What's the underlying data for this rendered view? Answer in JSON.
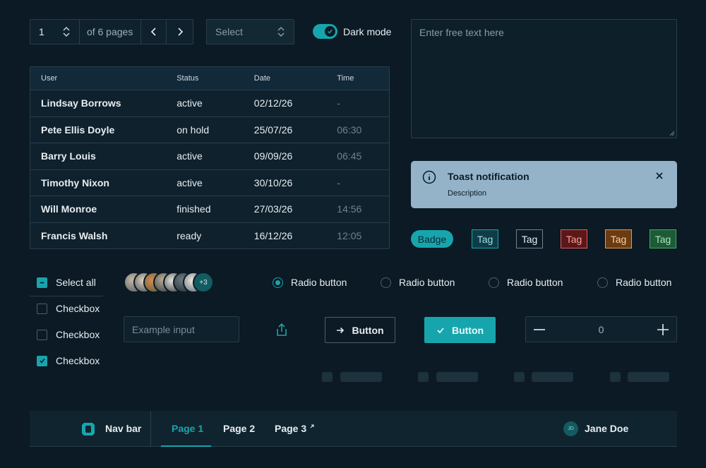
{
  "pagination": {
    "current": "1",
    "of_label": "of 6 pages"
  },
  "select": {
    "placeholder": "Select"
  },
  "dark_mode": {
    "label": "Dark mode",
    "on": true
  },
  "textarea": {
    "placeholder": "Enter free text here"
  },
  "table": {
    "headers": [
      "User",
      "Status",
      "Date",
      "Time"
    ],
    "rows": [
      [
        "Lindsay Borrows",
        "active",
        "02/12/26",
        "-"
      ],
      [
        "Pete Ellis Doyle",
        "on hold",
        "25/07/26",
        "06:30"
      ],
      [
        "Barry Louis",
        "active",
        "09/09/26",
        "06:45"
      ],
      [
        "Timothy Nixon",
        "active",
        "30/10/26",
        "-"
      ],
      [
        "Will Monroe",
        "finished",
        "27/03/26",
        "14:56"
      ],
      [
        "Francis Walsh",
        "ready",
        "16/12/26",
        "12:05"
      ]
    ]
  },
  "toast": {
    "title": "Toast notification",
    "description": "Description"
  },
  "badge": {
    "label": "Badge"
  },
  "tags": [
    {
      "label": "Tag",
      "color": "#17a5ad"
    },
    {
      "label": "Tag",
      "color": "#9fb0bb"
    },
    {
      "label": "Tag",
      "color": "#e25a5a"
    },
    {
      "label": "Tag",
      "color": "#e79a4e"
    },
    {
      "label": "Tag",
      "color": "#3fae6a"
    }
  ],
  "checkboxes": {
    "select_all": "Select all",
    "items": [
      {
        "label": "Checkbox",
        "checked": false
      },
      {
        "label": "Checkbox",
        "checked": false
      },
      {
        "label": "Checkbox",
        "checked": true
      }
    ]
  },
  "avatars": {
    "more": "+3"
  },
  "radios": [
    {
      "label": "Radio button",
      "selected": true
    },
    {
      "label": "Radio button",
      "selected": false
    },
    {
      "label": "Radio button",
      "selected": false
    },
    {
      "label": "Radio button",
      "selected": false
    }
  ],
  "input": {
    "placeholder": "Example input"
  },
  "buttons": {
    "outline": "Button",
    "filled": "Button"
  },
  "stepper": {
    "value": "0"
  },
  "navbar": {
    "brand": "Nav bar",
    "tabs": [
      "Page 1",
      "Page 2",
      "Page 3"
    ],
    "user_initials": "JD",
    "user_name": "Jane Doe"
  },
  "colors": {
    "accent": "#17a5ad",
    "background": "#0b1a24"
  }
}
